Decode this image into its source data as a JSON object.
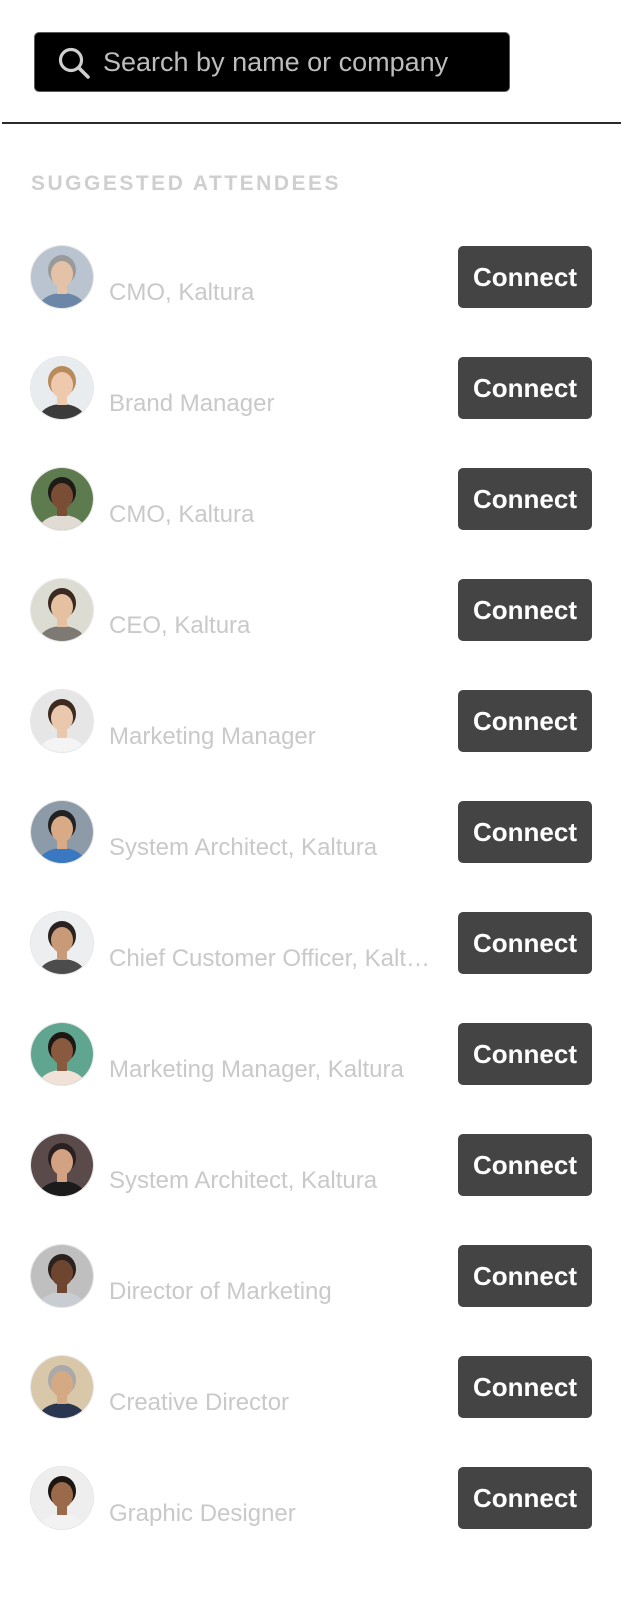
{
  "search": {
    "placeholder": "Search by name or company",
    "value": "",
    "icon": "search-icon"
  },
  "section": {
    "title": "SUGGESTED ATTENDEES"
  },
  "connect_label": "Connect",
  "attendees": [
    {
      "name": "",
      "title": "CMO, Kaltura",
      "avatar_bg": "#b9c4d0",
      "skin": "#e3c2a8",
      "hair": "#9a9a9a",
      "shirt": "#6b86a6"
    },
    {
      "name": "",
      "title": "Brand Manager",
      "avatar_bg": "#e9ecef",
      "skin": "#efc9ad",
      "hair": "#b98a5a",
      "shirt": "#3b3b3b"
    },
    {
      "name": "",
      "title": "CMO, Kaltura",
      "avatar_bg": "#5e7a4f",
      "skin": "#7a4e34",
      "hair": "#1e1a18",
      "shirt": "#e0dcd4"
    },
    {
      "name": "",
      "title": "CEO, Kaltura",
      "avatar_bg": "#dcdcd2",
      "skin": "#e6c1a1",
      "hair": "#3a2a20",
      "shirt": "#7d7a74"
    },
    {
      "name": "",
      "title": "Marketing Manager",
      "avatar_bg": "#e6e6e6",
      "skin": "#e9c8ae",
      "hair": "#3d2b20",
      "shirt": "#f4f4f4"
    },
    {
      "name": "",
      "title": "System Architect, Kaltura",
      "avatar_bg": "#8d9aa8",
      "skin": "#d9aa86",
      "hair": "#222222",
      "shirt": "#3a78c2"
    },
    {
      "name": "",
      "title": "Chief Customer Officer, Kaltura",
      "avatar_bg": "#eceef0",
      "skin": "#c99a78",
      "hair": "#2a2220",
      "shirt": "#4c4c4c"
    },
    {
      "name": "",
      "title": "Marketing Manager, Kaltura",
      "avatar_bg": "#5fa58f",
      "skin": "#8a5a3e",
      "hair": "#1e1814",
      "shirt": "#f0e2d6"
    },
    {
      "name": "",
      "title": "System Architect, Kaltura",
      "avatar_bg": "#5a4a4a",
      "skin": "#d3a283",
      "hair": "#2b2020",
      "shirt": "#1b1b1b"
    },
    {
      "name": "",
      "title": "Director of Marketing",
      "avatar_bg": "#bfbfbf",
      "skin": "#6e4630",
      "hair": "#2b2220",
      "shirt": "#c9ccd2"
    },
    {
      "name": "",
      "title": "Creative Director",
      "avatar_bg": "#d8c7a8",
      "skin": "#d6a985",
      "hair": "#a9a9a9",
      "shirt": "#2a3550"
    },
    {
      "name": "",
      "title": "Graphic Designer",
      "avatar_bg": "#eeeeee",
      "skin": "#9a6a4a",
      "hair": "#1c1512",
      "shirt": "#f2f2f2"
    }
  ]
}
